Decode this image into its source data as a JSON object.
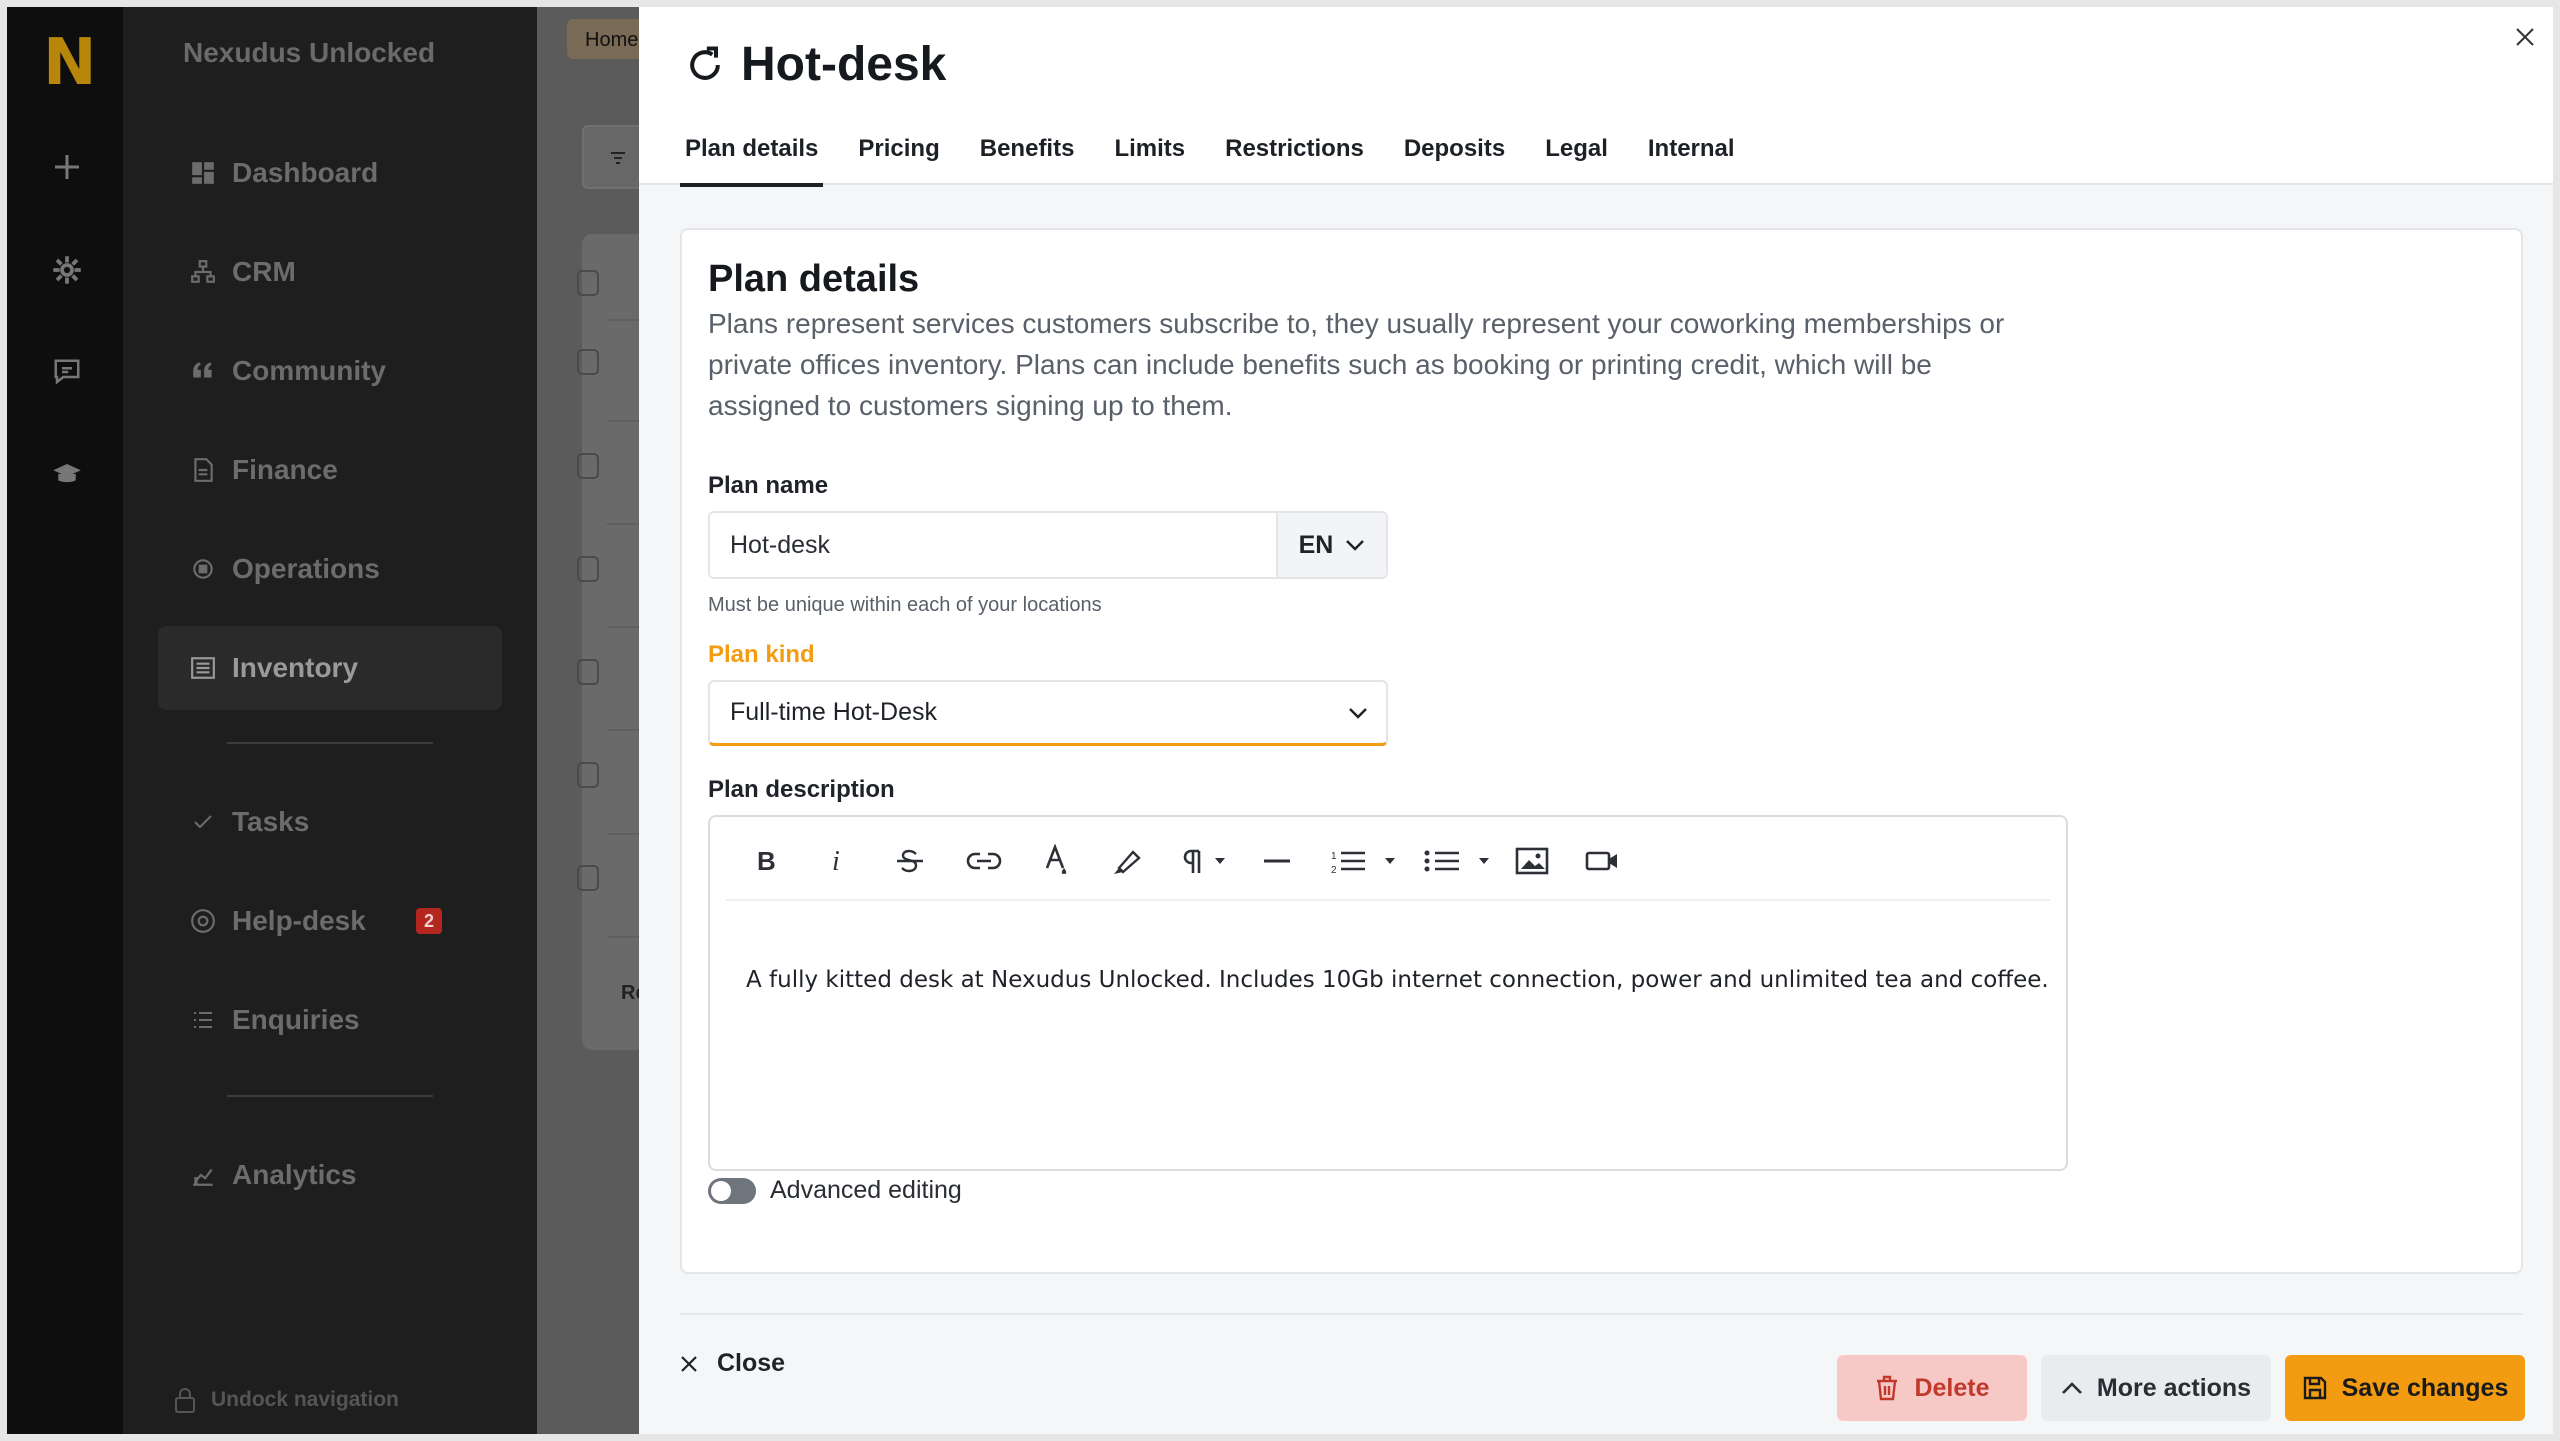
{
  "app": {
    "logo_letter": "N",
    "brand": "Nexudus Unlocked"
  },
  "rail": {
    "icons": [
      "plus-icon",
      "gear-icon",
      "feedback-icon",
      "graduation-cap-icon"
    ]
  },
  "nav": {
    "items": [
      {
        "label": "Dashboard",
        "icon": "dashboard-icon"
      },
      {
        "label": "CRM",
        "icon": "crm-icon"
      },
      {
        "label": "Community",
        "icon": "quote-icon"
      },
      {
        "label": "Finance",
        "icon": "document-icon"
      },
      {
        "label": "Operations",
        "icon": "chip-icon"
      },
      {
        "label": "Inventory",
        "icon": "inventory-icon",
        "active": true
      },
      {
        "label": "Tasks",
        "icon": "check-icon"
      },
      {
        "label": "Help-desk",
        "icon": "lifebuoy-icon",
        "badge": "2"
      },
      {
        "label": "Enquiries",
        "icon": "list-icon"
      },
      {
        "label": "Analytics",
        "icon": "chart-icon"
      }
    ],
    "unlock_label": "Undock navigation"
  },
  "background": {
    "breadcrumb": "Home",
    "row_label": "Re"
  },
  "panel": {
    "title": "Hot-desk",
    "tabs": [
      "Plan details",
      "Pricing",
      "Benefits",
      "Limits",
      "Restrictions",
      "Deposits",
      "Legal",
      "Internal"
    ],
    "active_tab": "Plan details",
    "section": {
      "title": "Plan details",
      "description": "Plans represent services customers subscribe to, they usually represent your coworking memberships or private offices inventory. Plans can include benefits such as booking or printing credit, which will be assigned to customers signing up to them."
    },
    "plan_name": {
      "label": "Plan name",
      "value": "Hot-desk",
      "language": "EN",
      "helper": "Must be unique within each of your locations"
    },
    "plan_kind": {
      "label": "Plan kind",
      "value": "Full-time Hot-Desk"
    },
    "plan_description": {
      "label": "Plan description",
      "content": "A fully kitted desk at Nexudus Unlocked. Includes 10Gb internet connection, power and unlimited tea and coffee."
    },
    "advanced_editing": {
      "label": "Advanced editing",
      "enabled": false
    },
    "footer": {
      "close": "Close",
      "delete": "Delete",
      "more_actions": "More actions",
      "save": "Save changes"
    }
  },
  "colors": {
    "accent": "#f39c12",
    "danger": "#c0392b",
    "danger_bg": "#f7c9c6"
  }
}
